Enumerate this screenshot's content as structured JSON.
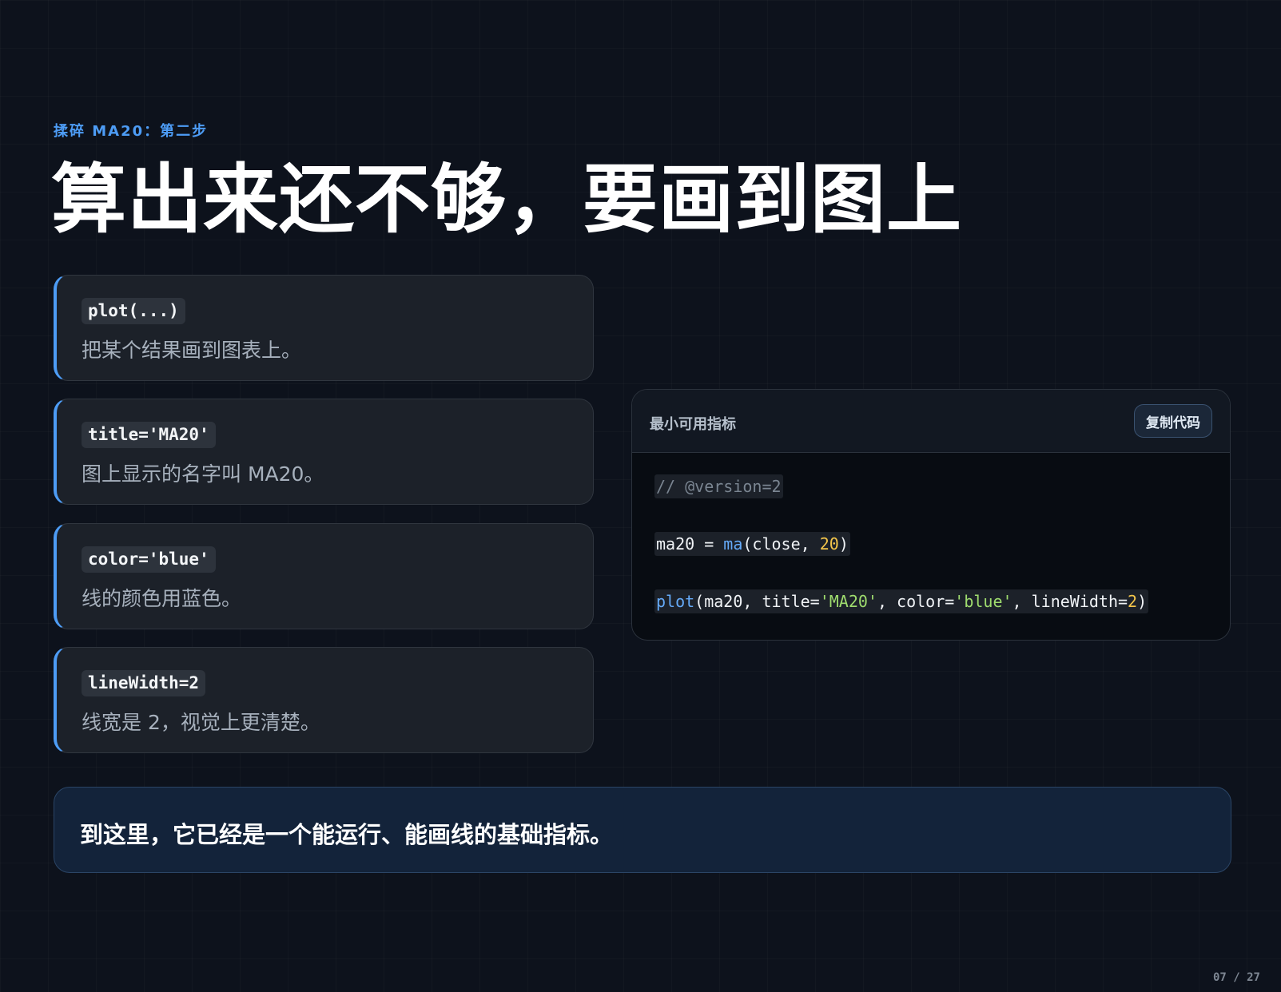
{
  "eyebrow": "揉碎 MA20：第二步",
  "title": "算出来还不够，要画到图上",
  "params": [
    {
      "code": "plot(...)",
      "desc": "把某个结果画到图表上。"
    },
    {
      "code": "title='MA20'",
      "desc": "图上显示的名字叫 MA20。"
    },
    {
      "code": "color='blue'",
      "desc": "线的颜色用蓝色。"
    },
    {
      "code": "lineWidth=2",
      "desc": "线宽是 2，视觉上更清楚。"
    }
  ],
  "code_panel": {
    "title": "最小可用指标",
    "copy_label": "复制代码",
    "lines": [
      [
        {
          "t": "// @version=2",
          "c": "comment"
        }
      ],
      [
        {
          "t": "ma20 = ",
          "c": "plain"
        },
        {
          "t": "ma",
          "c": "fn"
        },
        {
          "t": "(close, ",
          "c": "plain"
        },
        {
          "t": "20",
          "c": "num"
        },
        {
          "t": ")",
          "c": "plain"
        }
      ],
      [
        {
          "t": "plot",
          "c": "fn"
        },
        {
          "t": "(ma20, title=",
          "c": "plain"
        },
        {
          "t": "'MA20'",
          "c": "str"
        },
        {
          "t": ", color=",
          "c": "plain"
        },
        {
          "t": "'blue'",
          "c": "str"
        },
        {
          "t": ", lineWidth=",
          "c": "plain"
        },
        {
          "t": "2",
          "c": "num"
        },
        {
          "t": ")",
          "c": "plain"
        }
      ]
    ]
  },
  "summary": "到这里，它已经是一个能运行、能画线的基础指标。",
  "page_number": "07 / 27",
  "colors": {
    "accent": "#4d9cf5",
    "background": "#0d121c",
    "code_function": "#65aaf8",
    "code_string": "#9fdc6e",
    "code_number": "#f3c54b",
    "code_comment": "#7a8591"
  }
}
